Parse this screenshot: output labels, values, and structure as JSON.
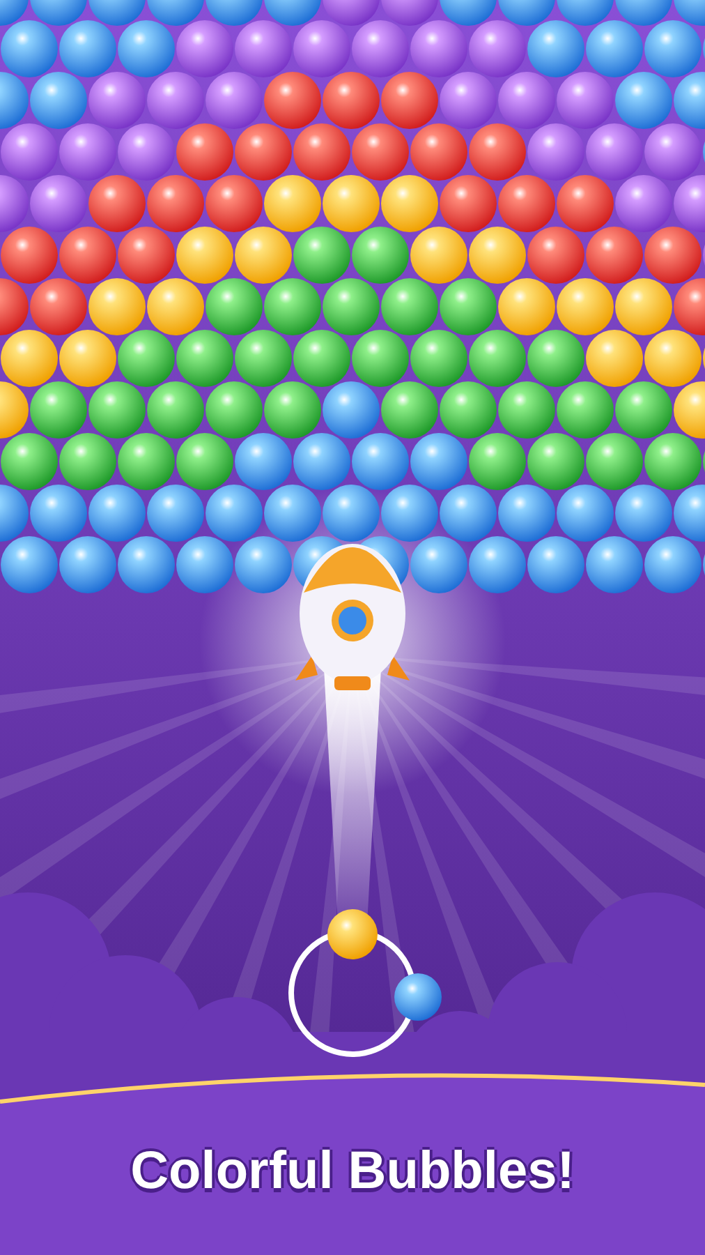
{
  "caption": "Colorful Bubbles!"
}
